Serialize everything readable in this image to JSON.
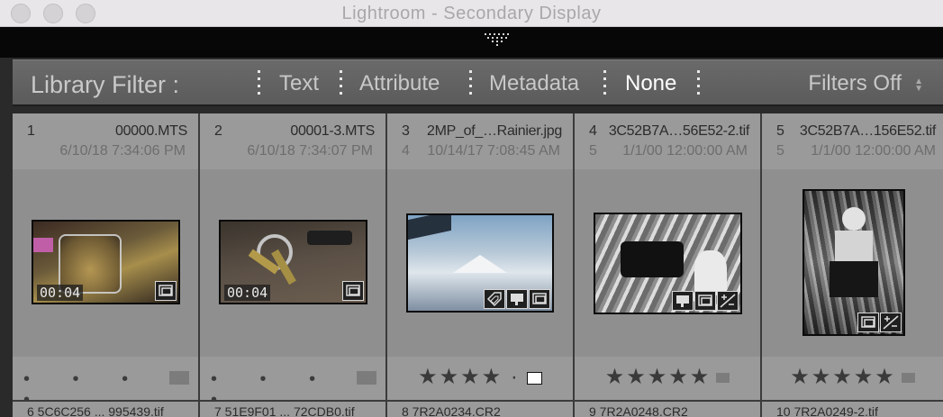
{
  "window": {
    "title": "Lightroom - Secondary Display"
  },
  "filter_bar": {
    "title": "Library Filter :",
    "items": [
      {
        "label": "Text",
        "active": false
      },
      {
        "label": "Attribute",
        "active": false
      },
      {
        "label": "Metadata",
        "active": false
      },
      {
        "label": "None",
        "active": true
      }
    ],
    "preset": "Filters Off"
  },
  "cells": [
    {
      "index": "1",
      "name": "00000.MTS",
      "index2": "",
      "date": "6/10/18 7:34:06 PM",
      "duration": "00:04",
      "rating": "• • • • •",
      "icons": [
        "stack-icon"
      ]
    },
    {
      "index": "2",
      "name": "00001-3.MTS",
      "index2": "",
      "date": "6/10/18 7:34:07 PM",
      "duration": "00:04",
      "rating": "• • • • •",
      "icons": [
        "stack-icon"
      ]
    },
    {
      "index": "3",
      "name": "2MP_of_…Rainier.jpg",
      "index2": "4",
      "date": "10/14/17 7:08:45 AM",
      "duration": "",
      "rating": "★★★★ ·",
      "icons": [
        "keyword-icon",
        "comment-icon",
        "stack-icon"
      ]
    },
    {
      "index": "4",
      "name": "3C52B7A…56E52-2.tif",
      "index2": "5",
      "date": "1/1/00 12:00:00 AM",
      "duration": "",
      "rating": "★★★★★",
      "icons": [
        "comment-icon",
        "stack-icon",
        "develop-adjust-icon"
      ]
    },
    {
      "index": "5",
      "name": "3C52B7A…156E52.tif",
      "index2": "5",
      "date": "1/1/00 12:00:00 AM",
      "duration": "",
      "rating": "★★★★★",
      "icons": [
        "stack-icon",
        "develop-adjust-icon"
      ]
    }
  ],
  "next_row": [
    {
      "text": "6   5C6C256 ... 995439.tif"
    },
    {
      "text": "7   51E9F01 ... 72CDB0.tif"
    },
    {
      "text": "8   7R2A0234.CR2"
    },
    {
      "text": "9   7R2A0248.CR2"
    },
    {
      "text": "10  7R2A0249-2.tif"
    }
  ]
}
